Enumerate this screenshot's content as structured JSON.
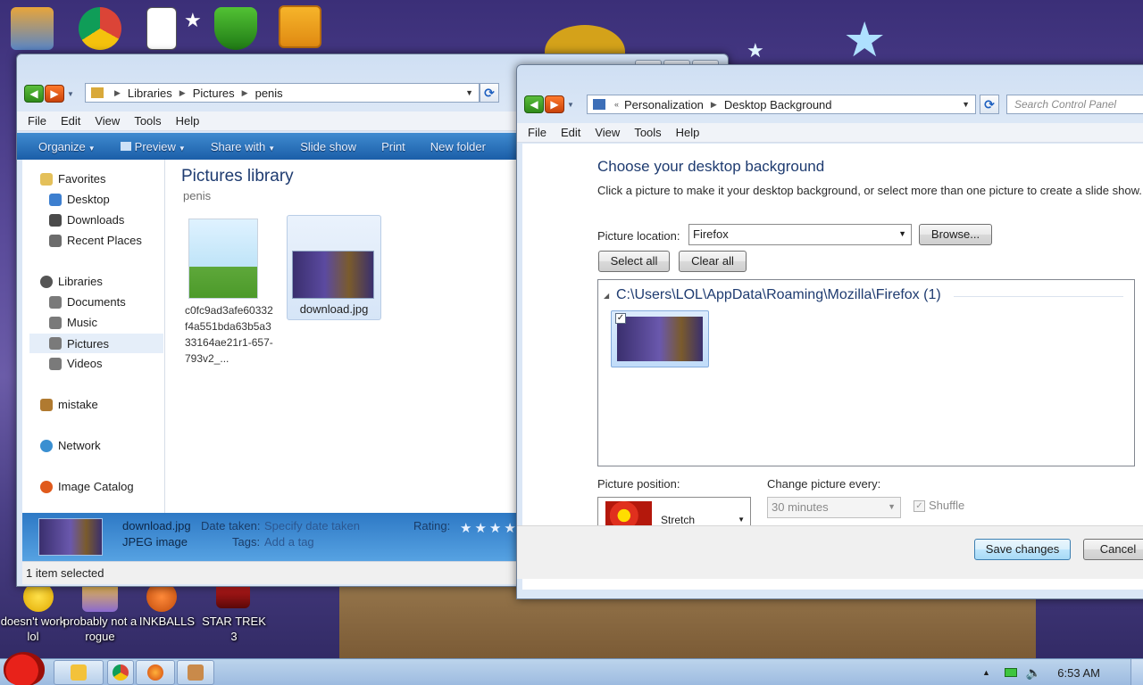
{
  "desktop": {
    "icons": [
      {
        "label": "doesn't work lol",
        "icon": "yahoo-icon"
      },
      {
        "label": "probably not a rogue",
        "icon": "gear-icon"
      },
      {
        "label": "INKBALLS",
        "icon": "inkball-icon"
      },
      {
        "label": "STAR TREK 3",
        "icon": "startrek-icon"
      }
    ],
    "top_icons": [
      "computer-icon",
      "chrome-icon",
      "solitaire-icon",
      "star-icon",
      "shield-icon",
      "bad-piggies-icon"
    ]
  },
  "explorer": {
    "address": [
      "Libraries",
      "Pictures",
      "penis"
    ],
    "menu": [
      "File",
      "Edit",
      "View",
      "Tools",
      "Help"
    ],
    "toolbar": {
      "organize": "Organize",
      "preview": "Preview",
      "share_with": "Share with",
      "slide_show": "Slide show",
      "print": "Print",
      "new_folder": "New folder"
    },
    "nav": {
      "favorites": "Favorites",
      "desktop": "Desktop",
      "downloads": "Downloads",
      "recent_places": "Recent Places",
      "libraries": "Libraries",
      "documents": "Documents",
      "music": "Music",
      "pictures": "Pictures",
      "videos": "Videos",
      "mistake": "mistake",
      "network": "Network",
      "image_catalog": "Image Catalog"
    },
    "library_title": "Pictures library",
    "library_subtitle": "penis",
    "files": [
      {
        "name": "c0fc9ad3afe60332f4a551bda63b5a333164ae21r1-657-793v2_..."
      },
      {
        "name": "download.jpg"
      }
    ],
    "details": {
      "filename": "download.jpg",
      "filetype": "JPEG image",
      "date_taken_label": "Date taken:",
      "date_taken_value": "Specify date taken",
      "tags_label": "Tags:",
      "tags_value": "Add a tag",
      "rating_label": "Rating:",
      "rating_stars": "★★★★"
    },
    "status": "1 item selected"
  },
  "control_panel": {
    "address": [
      "Personalization",
      "Desktop Background"
    ],
    "search_placeholder": "Search Control Panel",
    "menu": [
      "File",
      "Edit",
      "View",
      "Tools",
      "Help"
    ],
    "heading": "Choose your desktop background",
    "description": "Click a picture to make it your desktop background, or select more than one picture to create a slide show.",
    "picture_location_label": "Picture location:",
    "picture_location_value": "Firefox",
    "browse_button": "Browse...",
    "select_all_button": "Select all",
    "clear_all_button": "Clear all",
    "folder_header": "C:\\Users\\LOL\\AppData\\Roaming\\Mozilla\\Firefox (1)",
    "picture_position_label": "Picture position:",
    "picture_position_value": "Stretch",
    "change_every_label": "Change picture every:",
    "change_every_value": "30 minutes",
    "shuffle_label": "Shuffle",
    "save_button": "Save changes",
    "cancel_button": "Cancel"
  },
  "taskbar": {
    "time": "6:53 AM"
  }
}
